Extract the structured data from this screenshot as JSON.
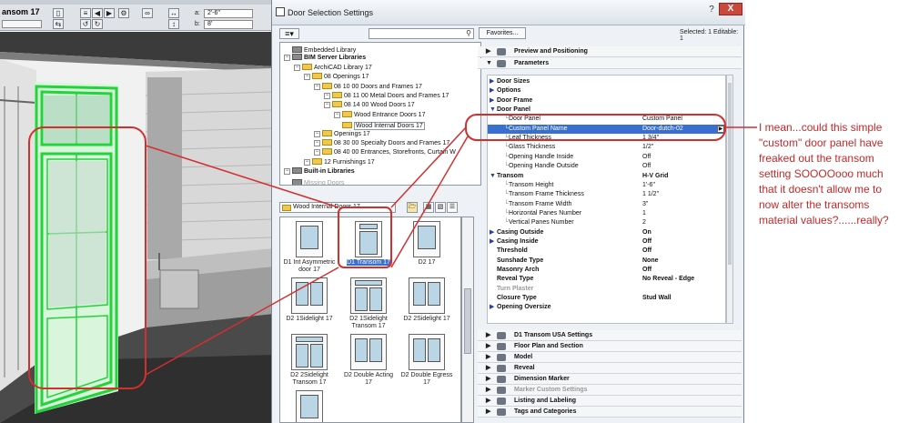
{
  "toolbar": {
    "title": "ansom 17",
    "field_a_label": "a:",
    "field_a_value": "2'-6\"",
    "field_b_label": "b:",
    "field_b_value": "8'"
  },
  "dialog": {
    "title": "Door Selection Settings",
    "help_label": "?",
    "close_label": "X",
    "favorites_label": "Favorites...",
    "selected_info": "Selected: 1 Editable: 1"
  },
  "library_tree": [
    {
      "label": "Embedded Library",
      "indent": 1,
      "type": "doc"
    },
    {
      "label": "BIM Server Libraries",
      "indent": 1,
      "type": "bold"
    },
    {
      "label": "ArchiCAD Library 17",
      "indent": 2,
      "type": "folder"
    },
    {
      "label": "08 Openings 17",
      "indent": 3,
      "type": "folder"
    },
    {
      "label": "08 10 00 Doors and Frames 17",
      "indent": 4,
      "type": "folder"
    },
    {
      "label": "08 11 00 Metal Doors and Frames 17",
      "indent": 5,
      "type": "folder"
    },
    {
      "label": "08 14 00 Wood Doors 17",
      "indent": 5,
      "type": "folder"
    },
    {
      "label": "Wood Entrance Doors 17",
      "indent": 6,
      "type": "folder"
    },
    {
      "label": "Wood Internal Doors 17",
      "indent": 6,
      "type": "folder-hl"
    },
    {
      "label": "Openings 17",
      "indent": 4,
      "type": "folder"
    },
    {
      "label": "08 30 00 Specialty Doors and Frames 17",
      "indent": 4,
      "type": "folder"
    },
    {
      "label": "08 40 00 Entrances, Storefronts, Curtain W",
      "indent": 4,
      "type": "folder"
    },
    {
      "label": "12 Furnishings 17",
      "indent": 3,
      "type": "folder"
    },
    {
      "label": "Built-in Libraries",
      "indent": 1,
      "type": "bold"
    },
    {
      "label": "Missing Doors",
      "indent": 1,
      "type": "gray"
    }
  ],
  "folder_selector": "Wood Internal Doors 17",
  "library_items": [
    {
      "label": "D1 Int Asymmetric door 17",
      "selected": false
    },
    {
      "label": "D1 Transom 17",
      "selected": true
    },
    {
      "label": "D2 17",
      "selected": false
    },
    {
      "label": "D2 1Sidelight 17",
      "selected": false
    },
    {
      "label": "D2 1Sidelight Transom 17",
      "selected": false
    },
    {
      "label": "D2 2Sidelight 17",
      "selected": false
    },
    {
      "label": "D2 2Sidelight Transom 17",
      "selected": false
    },
    {
      "label": "D2 Double Acting 17",
      "selected": false
    },
    {
      "label": "D2 Double Egress 17",
      "selected": false
    },
    {
      "label": "",
      "selected": false
    }
  ],
  "panels_top": [
    {
      "label": "Preview and Positioning",
      "expanded": false
    },
    {
      "label": "Parameters",
      "expanded": true
    }
  ],
  "parameters": [
    {
      "name": "Door Sizes",
      "value": "",
      "kind": "group-collapsed"
    },
    {
      "name": "Options",
      "value": "",
      "kind": "group-collapsed"
    },
    {
      "name": "Door Frame",
      "value": "",
      "kind": "group-collapsed"
    },
    {
      "name": "Door Panel",
      "value": "",
      "kind": "group-expanded"
    },
    {
      "name": "Door Panel",
      "value": "Custom Panel",
      "kind": "sub"
    },
    {
      "name": "Custom Panel Name",
      "value": "Door-dutch-02",
      "kind": "sub-selected"
    },
    {
      "name": "Leaf Thickness",
      "value": "1 3/4\"",
      "kind": "sub"
    },
    {
      "name": "Glass Thickness",
      "value": "1/2\"",
      "kind": "sub"
    },
    {
      "name": "Opening Handle Inside",
      "value": "Off",
      "kind": "sub"
    },
    {
      "name": "Opening Handle Outside",
      "value": "Off",
      "kind": "sub"
    },
    {
      "name": "Transom",
      "value": "H-V Grid",
      "kind": "group-expanded"
    },
    {
      "name": "Transom Height",
      "value": "1'-6\"",
      "kind": "sub"
    },
    {
      "name": "Transom Frame Thickness",
      "value": "1 1/2\"",
      "kind": "sub"
    },
    {
      "name": "Transom Frame Width",
      "value": "3\"",
      "kind": "sub"
    },
    {
      "name": "Horizontal Panes Number",
      "value": "1",
      "kind": "sub"
    },
    {
      "name": "Vertical Panes Number",
      "value": "2",
      "kind": "sub"
    },
    {
      "name": "Casing Outside",
      "value": "On",
      "kind": "group-collapsed"
    },
    {
      "name": "Casing Inside",
      "value": "Off",
      "kind": "group-collapsed"
    },
    {
      "name": "Threshold",
      "value": "Off",
      "kind": "bold"
    },
    {
      "name": "Sunshade Type",
      "value": "None",
      "kind": "bold"
    },
    {
      "name": "Masonry Arch",
      "value": "Off",
      "kind": "bold"
    },
    {
      "name": "Reveal Type",
      "value": "No Reveal - Edge",
      "kind": "bold"
    },
    {
      "name": "Turn Plaster",
      "value": "",
      "kind": "gray"
    },
    {
      "name": "Closure Type",
      "value": "Stud Wall",
      "kind": "bold"
    },
    {
      "name": "Opening Oversize",
      "value": "",
      "kind": "group-collapsed"
    }
  ],
  "panels_bottom": [
    {
      "label": "D1 Transom USA Settings",
      "gray": false
    },
    {
      "label": "Floor Plan and Section",
      "gray": false
    },
    {
      "label": "Model",
      "gray": false
    },
    {
      "label": "Reveal",
      "gray": false
    },
    {
      "label": "Dimension Marker",
      "gray": false
    },
    {
      "label": "Marker Custom Settings",
      "gray": true
    },
    {
      "label": "Listing and Labeling",
      "gray": false
    },
    {
      "label": "Tags and Categories",
      "gray": false
    }
  ],
  "annotation": "I mean...could this simple \"custom\" door panel have freaked out the transom setting SOOOOooo much that it doesn't allow me to now alter the transoms material values?......really?",
  "colors": {
    "annotation_red": "#d32f2f",
    "selection_blue": "#3a6fd2",
    "door_green": "#22d33a"
  }
}
